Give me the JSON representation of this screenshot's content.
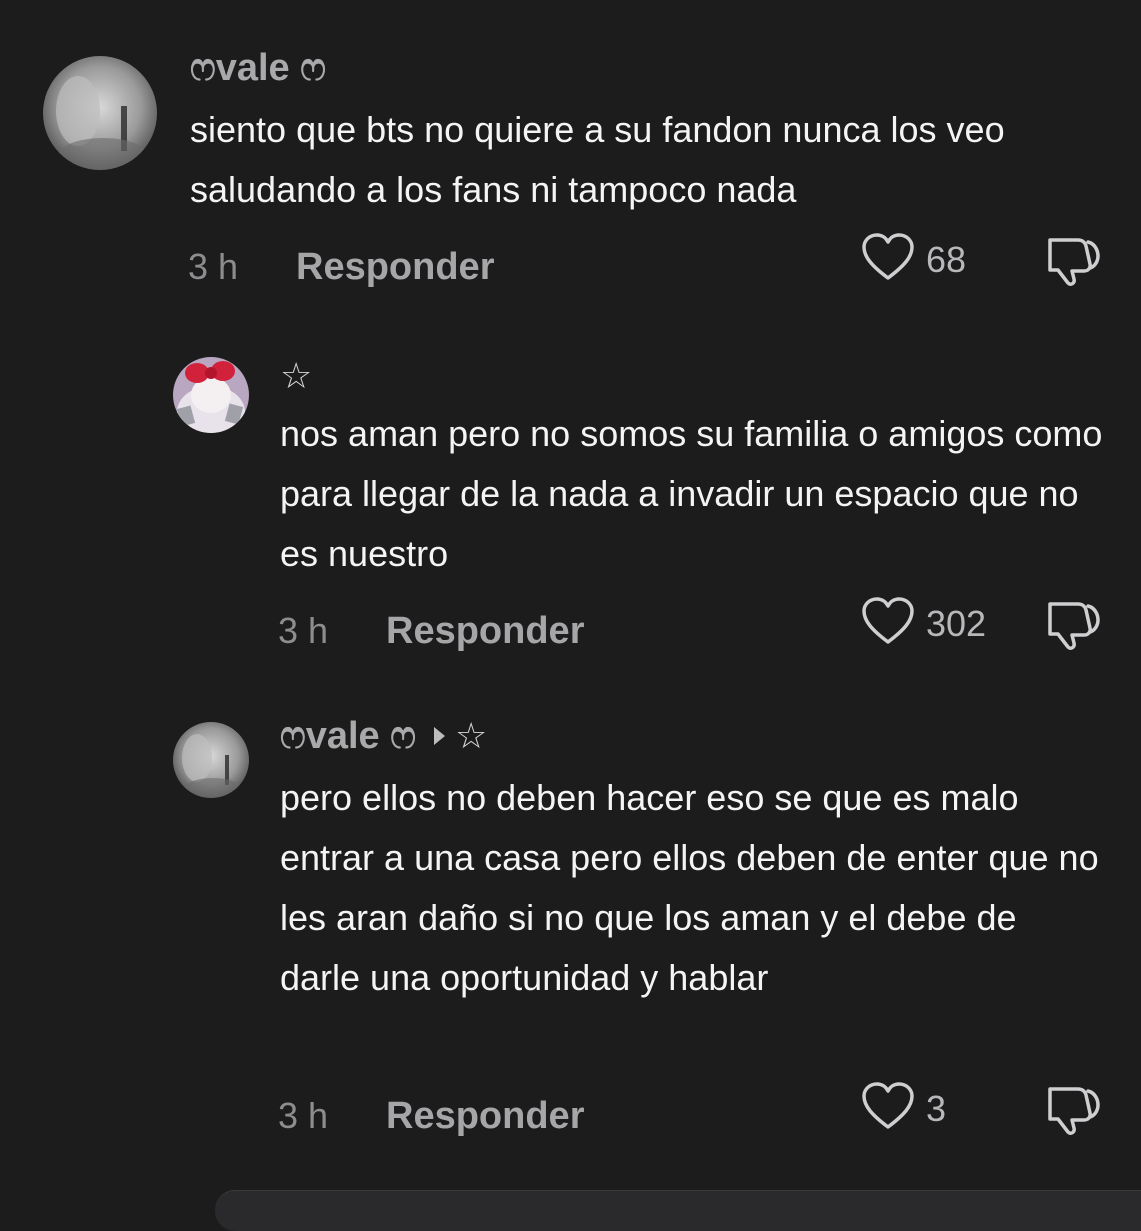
{
  "comments": [
    {
      "username": "ෆvale ෆ",
      "text": "siento que bts no quiere a su fandon nunca los veo saludando a los fans ni tampoco nada",
      "time": "3 h",
      "reply_label": "Responder",
      "likes": "68"
    },
    {
      "username": "☆",
      "text": "nos aman pero no somos su familia o amigos como para llegar de la nada a invadir un espacio que no es nuestro",
      "time": "3 h",
      "reply_label": "Responder",
      "likes": "302"
    },
    {
      "username": "ෆvale ෆ",
      "reply_to": "☆",
      "text": "pero ellos no deben hacer eso se que es malo entrar a una casa pero ellos deben de enter que no les aran daño si no que los aman y el debe de darle una oportunidad y hablar",
      "time": "3 h",
      "reply_label": "Responder",
      "likes": "3"
    }
  ],
  "icons": {
    "like": "heart-outline-icon",
    "dislike": "thumbs-down-outline-icon",
    "reply_arrow": "caret-right-icon"
  },
  "colors": {
    "background": "#1c1c1d",
    "username": "#a9a9ab",
    "body_text": "#f4f4f4",
    "meta_text": "#8d8d90"
  }
}
